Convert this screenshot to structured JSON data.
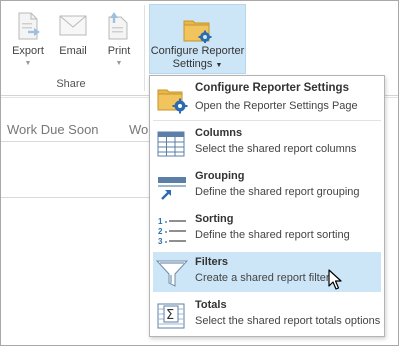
{
  "ribbon": {
    "export_label": "Export",
    "email_label": "Email",
    "print_label": "Print",
    "share_group_label": "Share",
    "configure_line1": "Configure Reporter",
    "configure_line2": "Settings"
  },
  "page": {
    "tab1": "Work Due Soon",
    "tab2": "Wo"
  },
  "menu": {
    "items": [
      {
        "title": "Configure Reporter Settings",
        "desc": "Open the Reporter Settings Page",
        "icon": "folder-gear-icon"
      },
      {
        "title": "Columns",
        "desc": "Select the shared report columns",
        "icon": "columns-grid-icon"
      },
      {
        "title": "Grouping",
        "desc": "Define the shared report grouping",
        "icon": "grouping-icon"
      },
      {
        "title": "Sorting",
        "desc": "Define the shared report sorting",
        "icon": "sorting-icon"
      },
      {
        "title": "Filters",
        "desc": "Create a shared report filter",
        "icon": "funnel-icon"
      },
      {
        "title": "Totals",
        "desc": "Select the shared report totals options",
        "icon": "sigma-grid-icon"
      }
    ]
  },
  "colors": {
    "highlight": "#cde6f7",
    "icon_blue": "#2b6cb0",
    "folder_yellow": "#e8b74a"
  }
}
